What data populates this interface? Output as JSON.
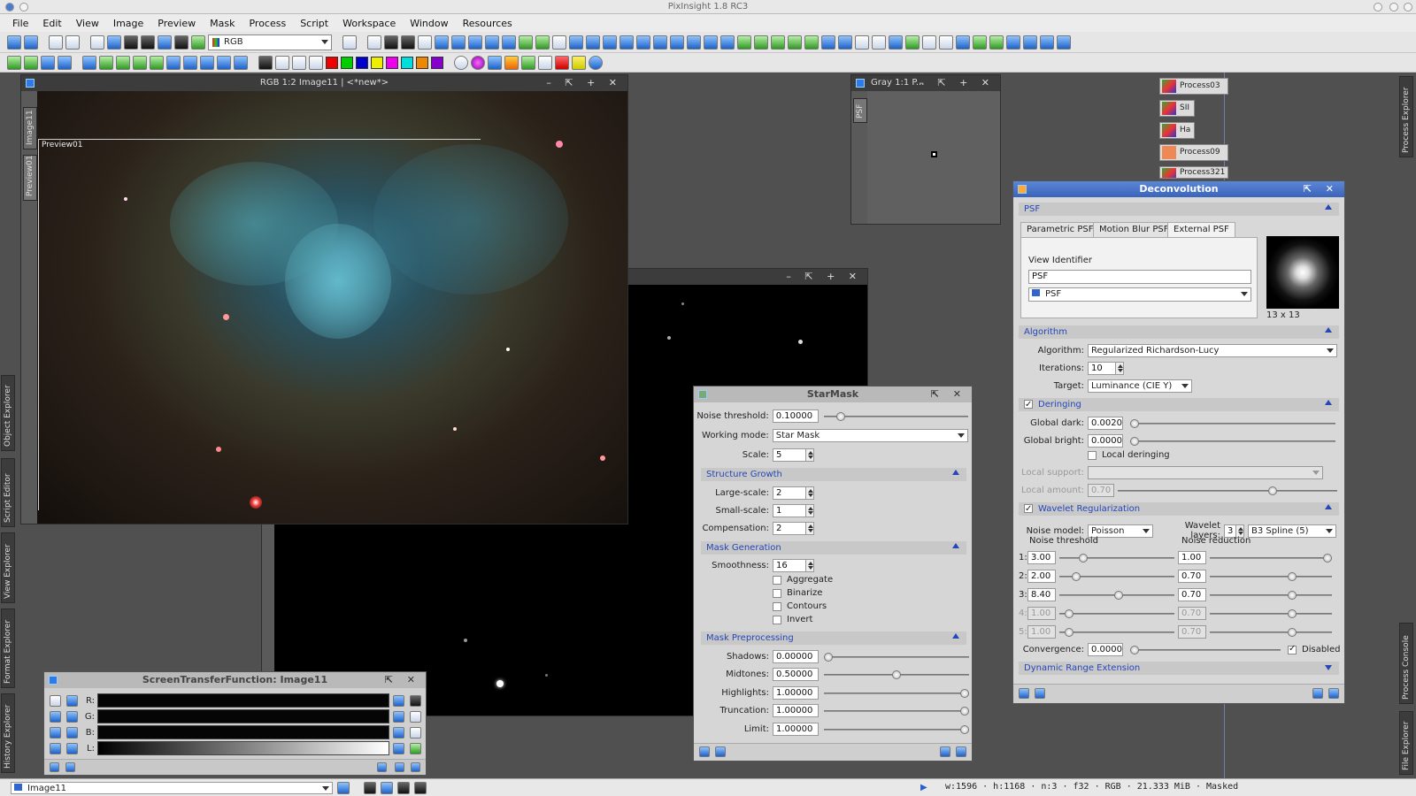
{
  "app": {
    "title": "PixInsight 1.8 RC3"
  },
  "menu": [
    "File",
    "Edit",
    "View",
    "Image",
    "Preview",
    "Mask",
    "Process",
    "Script",
    "Workspace",
    "Window",
    "Resources"
  ],
  "toolbar": {
    "channel_combo": "RGB"
  },
  "side_tabs_left": [
    "Object Explorer",
    "Script Editor",
    "View Explorer",
    "Format Explorer",
    "History Explorer"
  ],
  "side_tabs_right": [
    "Process Explorer",
    "Process Console",
    "File Explorer"
  ],
  "image_window": {
    "title": "RGB 1:2 Image11 | <*new*>",
    "tabs": [
      "Image11",
      "Preview01"
    ],
    "preview_label": "Preview01"
  },
  "gray_window": {
    "title": "Gray 1:1 P...",
    "tab": "PSF"
  },
  "process_icons": [
    "Process03",
    "SII",
    "Ha",
    "Process09",
    "Process321"
  ],
  "starmask": {
    "title": "StarMask",
    "noise_threshold": {
      "label": "Noise threshold:",
      "value": "0.10000"
    },
    "working_mode": {
      "label": "Working mode:",
      "value": "Star Mask"
    },
    "scale": {
      "label": "Scale:",
      "value": "5"
    },
    "structure_growth": "Structure Growth",
    "large_scale": {
      "label": "Large-scale:",
      "value": "2"
    },
    "small_scale": {
      "label": "Small-scale:",
      "value": "1"
    },
    "compensation": {
      "label": "Compensation:",
      "value": "2"
    },
    "mask_generation": "Mask Generation",
    "smoothness": {
      "label": "Smoothness:",
      "value": "16"
    },
    "checks": [
      "Aggregate",
      "Binarize",
      "Contours",
      "Invert"
    ],
    "mask_preprocessing": "Mask Preprocessing",
    "shadows": {
      "label": "Shadows:",
      "value": "0.00000"
    },
    "midtones": {
      "label": "Midtones:",
      "value": "0.50000"
    },
    "highlights": {
      "label": "Highlights:",
      "value": "1.00000"
    },
    "truncation": {
      "label": "Truncation:",
      "value": "1.00000"
    },
    "limit": {
      "label": "Limit:",
      "value": "1.00000"
    }
  },
  "stf": {
    "title": "ScreenTransferFunction: Image11",
    "channels": [
      "R:",
      "G:",
      "B:",
      "L:"
    ]
  },
  "deconv": {
    "title": "Deconvolution",
    "psf_section": "PSF",
    "tabs": [
      "Parametric PSF",
      "Motion Blur PSF",
      "External PSF"
    ],
    "view_identifier_label": "View Identifier",
    "view_identifier_value": "PSF",
    "view_select": "PSF",
    "psf_size": "13 x 13",
    "algorithm_section": "Algorithm",
    "algorithm": {
      "label": "Algorithm:",
      "value": "Regularized Richardson-Lucy"
    },
    "iterations": {
      "label": "Iterations:",
      "value": "10"
    },
    "target": {
      "label": "Target:",
      "value": "Luminance (CIE Y)"
    },
    "deringing_section": "Deringing",
    "global_dark": {
      "label": "Global dark:",
      "value": "0.0020"
    },
    "global_bright": {
      "label": "Global bright:",
      "value": "0.0000"
    },
    "local_deringing": "Local deringing",
    "local_support": {
      "label": "Local support:"
    },
    "local_amount": {
      "label": "Local amount:",
      "value": "0.70"
    },
    "wavelet_section": "Wavelet Regularization",
    "noise_model": {
      "label": "Noise model:",
      "value": "Poisson"
    },
    "wavelet_layers": {
      "label": "Wavelet layers:",
      "value": "3"
    },
    "spline": "B3 Spline (5)",
    "noise_threshold_hdr": "Noise threshold",
    "noise_reduction_hdr": "Noise reduction",
    "layers": [
      {
        "n": "1:",
        "thr": "3.00",
        "red": "1.00"
      },
      {
        "n": "2:",
        "thr": "2.00",
        "red": "0.70"
      },
      {
        "n": "3:",
        "thr": "8.40",
        "red": "0.70"
      },
      {
        "n": "4:",
        "thr": "1.00",
        "red": "0.70"
      },
      {
        "n": "5:",
        "thr": "1.00",
        "red": "0.70"
      }
    ],
    "convergence": {
      "label": "Convergence:",
      "value": "0.0000"
    },
    "disabled": "Disabled",
    "dre_section": "Dynamic Range Extension"
  },
  "status": {
    "view": "Image11",
    "info": "w:1596 · h:1168 · n:3 · f32 · RGB · 21.333 MiB · Masked"
  }
}
